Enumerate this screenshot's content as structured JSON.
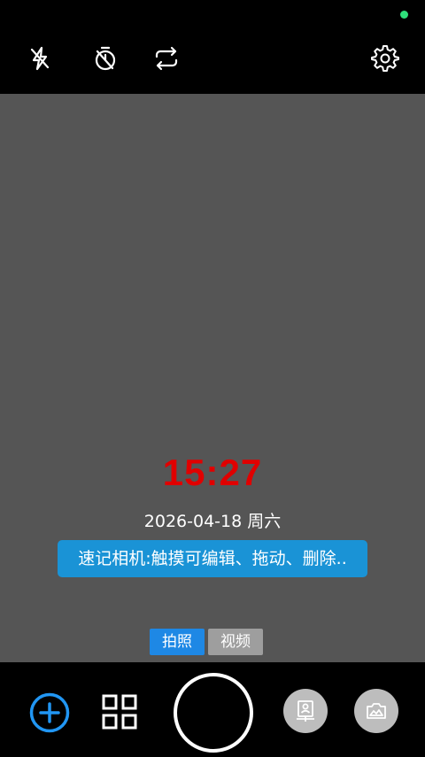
{
  "status": {
    "indicator_color": "#2ee07a"
  },
  "top_bar": {
    "icons": [
      "flash-off-icon",
      "timer-icon",
      "switch-camera-icon",
      "settings-icon"
    ]
  },
  "viewfinder": {
    "background_color": "#555555",
    "time": "15:27",
    "time_color": "#e00000",
    "date": "2026-04-18 周六",
    "note_banner": "速记相机:触摸可编辑、拖动、删除..",
    "note_banner_color": "#1a93d6"
  },
  "mode_tabs": [
    {
      "label": "拍照",
      "active": true,
      "color": "#1e88e5"
    },
    {
      "label": "视频",
      "active": false,
      "color": "#9e9e9e"
    }
  ],
  "bottom_bar": {
    "add_button_color": "#2196f3",
    "icons": [
      "add-icon",
      "grid-icon",
      "shutter-icon",
      "portrait-mode-icon",
      "gallery-icon"
    ]
  }
}
